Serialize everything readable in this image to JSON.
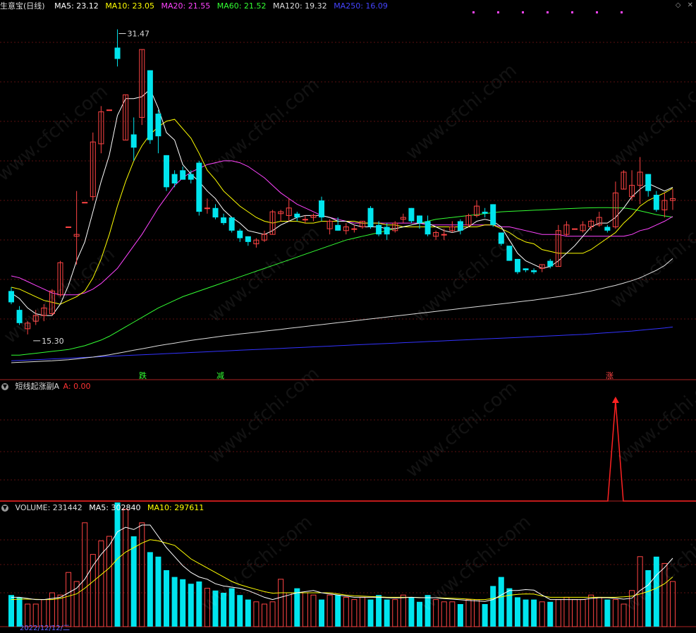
{
  "header": {
    "title": "生意宝(日线)",
    "ma": [
      {
        "label": "MA5: 23.12",
        "color": "#ffffff"
      },
      {
        "label": "MA10: 23.05",
        "color": "#ffff00"
      },
      {
        "label": "MA20: 21.55",
        "color": "#ff44ff"
      },
      {
        "label": "MA60: 21.52",
        "color": "#33ff33"
      },
      {
        "label": "MA120: 19.32",
        "color": "#dddddd"
      },
      {
        "label": "MA250: 16.09",
        "color": "#3333ff"
      }
    ]
  },
  "indicator": {
    "title": "短线起涨副A",
    "value_label": "A: 0.00",
    "value_color": "#ff3333"
  },
  "volume_header": {
    "vol_label": "VOLUME: 231442",
    "ma5_label": "MA5: 302840",
    "ma10_label": "MA10: 297611"
  },
  "annotations": {
    "high": "31.47",
    "low": "15.30"
  },
  "signals": [
    {
      "text": "跌",
      "color": "#33ff33"
    },
    {
      "text": "减",
      "color": "#33ff33"
    },
    {
      "text": "涨",
      "color": "#ff4444"
    }
  ],
  "date_label": "2022/12/12/二",
  "watermark": "www.cfchi.com",
  "colors": {
    "up": "#ff4444",
    "down": "#00e5ee",
    "ma5": "#ffffff",
    "ma10": "#ffff00",
    "ma20": "#ff44ff",
    "ma60": "#33ff33",
    "ma120": "#dddddd",
    "ma250": "#3333ff"
  },
  "chart_data": {
    "type": "candlestick",
    "ylim": [
      13.5,
      32.5
    ],
    "candles": [
      [
        17.6,
        17.8,
        16.9,
        17.0
      ],
      [
        16.6,
        16.8,
        15.8,
        15.9
      ],
      [
        15.6,
        16.0,
        15.3,
        15.9
      ],
      [
        16.0,
        16.6,
        15.8,
        16.3
      ],
      [
        16.3,
        16.9,
        16.0,
        16.7
      ],
      [
        16.4,
        17.7,
        16.3,
        17.6
      ],
      [
        17.4,
        19.2,
        17.3,
        19.1
      ],
      [
        21.0,
        21.0,
        21.0,
        21.0
      ],
      [
        20.5,
        22.9,
        19.0,
        20.6
      ],
      [
        22.3,
        22.3,
        22.3,
        22.3
      ],
      [
        22.6,
        26.0,
        22.4,
        25.5
      ],
      [
        25.4,
        27.4,
        24.9,
        27.1
      ],
      [
        27.2,
        27.2,
        27.2,
        27.2
      ],
      [
        30.5,
        31.47,
        29.5,
        29.9
      ],
      [
        25.6,
        28.0,
        25.6,
        28.0
      ],
      [
        25.9,
        26.8,
        24.5,
        25.2
      ],
      [
        26.8,
        30.4,
        26.4,
        30.4
      ],
      [
        29.3,
        29.3,
        25.4,
        25.6
      ],
      [
        27.0,
        27.2,
        24.9,
        25.8
      ],
      [
        24.8,
        24.8,
        22.9,
        23.1
      ],
      [
        23.8,
        24.0,
        23.1,
        23.3
      ],
      [
        24.0,
        24.2,
        23.5,
        23.5
      ],
      [
        23.8,
        24.0,
        23.3,
        23.5
      ],
      [
        24.4,
        24.5,
        21.6,
        21.8
      ],
      [
        22.0,
        22.5,
        21.7,
        22.0
      ],
      [
        22.0,
        22.2,
        21.4,
        21.5
      ],
      [
        21.5,
        21.7,
        21.1,
        21.2
      ],
      [
        21.5,
        21.5,
        20.7,
        20.8
      ],
      [
        20.8,
        20.9,
        20.2,
        20.4
      ],
      [
        20.5,
        20.5,
        20.0,
        20.2
      ],
      [
        20.1,
        20.4,
        19.9,
        20.3
      ],
      [
        20.3,
        20.8,
        20.2,
        20.6
      ],
      [
        20.6,
        21.9,
        20.6,
        21.8
      ],
      [
        21.7,
        21.9,
        21.3,
        21.8
      ],
      [
        21.6,
        22.5,
        21.3,
        22.0
      ],
      [
        21.7,
        21.8,
        21.3,
        21.5
      ],
      [
        21.4,
        21.6,
        21.2,
        21.4
      ],
      [
        21.5,
        21.7,
        21.3,
        21.6
      ],
      [
        22.4,
        22.6,
        21.3,
        21.5
      ],
      [
        20.9,
        21.4,
        20.6,
        21.3
      ],
      [
        21.1,
        21.5,
        20.8,
        20.8
      ],
      [
        20.8,
        21.2,
        20.6,
        21.0
      ],
      [
        20.9,
        21.1,
        20.7,
        20.9
      ],
      [
        21.0,
        21.3,
        20.9,
        21.3
      ],
      [
        22.0,
        22.1,
        20.9,
        21.0
      ],
      [
        21.1,
        21.3,
        20.5,
        20.6
      ],
      [
        21.0,
        21.2,
        20.3,
        20.6
      ],
      [
        20.8,
        21.3,
        20.7,
        21.2
      ],
      [
        21.4,
        21.7,
        21.2,
        21.5
      ],
      [
        22.0,
        22.0,
        21.2,
        21.3
      ],
      [
        21.6,
        21.6,
        20.9,
        21.2
      ],
      [
        21.3,
        21.6,
        20.5,
        20.6
      ],
      [
        20.5,
        20.8,
        20.3,
        20.7
      ],
      [
        20.6,
        20.9,
        20.3,
        20.6
      ],
      [
        20.8,
        21.3,
        20.7,
        21.0
      ],
      [
        21.3,
        21.4,
        20.6,
        20.8
      ],
      [
        21.1,
        21.7,
        21.0,
        21.6
      ],
      [
        21.6,
        22.4,
        21.5,
        22.1
      ],
      [
        21.8,
        22.0,
        21.5,
        21.7
      ],
      [
        22.2,
        22.2,
        21.0,
        21.1
      ],
      [
        20.7,
        20.7,
        20.0,
        20.1
      ],
      [
        20.0,
        20.0,
        19.2,
        19.2
      ],
      [
        19.3,
        19.3,
        18.5,
        18.6
      ],
      [
        18.8,
        18.8,
        18.6,
        18.7
      ],
      [
        18.7,
        18.8,
        18.5,
        18.6
      ],
      [
        18.8,
        19.0,
        18.6,
        19.0
      ],
      [
        19.2,
        19.3,
        18.8,
        18.9
      ],
      [
        18.9,
        21.1,
        18.9,
        20.8
      ],
      [
        20.6,
        21.3,
        20.5,
        21.1
      ],
      [
        20.9,
        20.9,
        20.9,
        20.9
      ],
      [
        20.8,
        21.3,
        20.7,
        21.1
      ],
      [
        21.0,
        21.4,
        20.8,
        21.3
      ],
      [
        21.1,
        21.8,
        21.0,
        21.5
      ],
      [
        21.0,
        21.1,
        20.7,
        20.8
      ],
      [
        21.0,
        23.4,
        20.9,
        22.8
      ],
      [
        23.0,
        24.0,
        23.0,
        23.9
      ],
      [
        22.6,
        24.0,
        22.4,
        23.2
      ],
      [
        23.2,
        24.7,
        22.2,
        23.9
      ],
      [
        23.8,
        23.8,
        22.6,
        22.9
      ],
      [
        22.7,
        22.9,
        21.8,
        21.9
      ],
      [
        21.9,
        22.8,
        21.5,
        22.4
      ],
      [
        22.4,
        23.0,
        21.9,
        22.5
      ]
    ],
    "ma5": [
      17.5,
      17.2,
      16.7,
      16.4,
      16.3,
      16.3,
      16.9,
      17.9,
      19.2,
      20.2,
      21.8,
      23.4,
      24.8,
      26.9,
      27.8,
      27.8,
      27.9,
      28.3,
      27.3,
      26.0,
      25.6,
      24.3,
      23.8,
      23.4,
      22.9,
      22.5,
      21.9,
      21.5,
      21.2,
      20.8,
      20.7,
      20.6,
      20.8,
      21.1,
      21.3,
      21.5,
      21.6,
      21.6,
      21.6,
      21.5,
      21.3,
      21.3,
      21.1,
      21.0,
      21.0,
      21.0,
      20.9,
      20.9,
      21.0,
      21.1,
      21.2,
      21.2,
      21.0,
      20.8,
      20.7,
      20.8,
      21.0,
      21.3,
      21.4,
      21.3,
      21.0,
      20.3,
      19.6,
      19.2,
      19.0,
      18.8,
      18.9,
      19.2,
      19.6,
      20.0,
      20.5,
      21.0,
      21.2,
      21.2,
      21.5,
      22.0,
      22.6,
      23.0,
      23.3,
      23.1,
      22.9,
      23.1
    ],
    "ma10": [
      17.8,
      17.7,
      17.5,
      17.3,
      17.1,
      17.0,
      16.9,
      17.1,
      17.3,
      17.6,
      18.3,
      19.3,
      20.6,
      22.1,
      23.4,
      24.5,
      25.3,
      25.9,
      26.3,
      26.6,
      26.7,
      26.2,
      25.7,
      24.9,
      24.0,
      23.5,
      22.9,
      22.5,
      22.1,
      21.8,
      21.5,
      21.3,
      21.2,
      21.3,
      21.3,
      21.3,
      21.2,
      21.2,
      21.3,
      21.3,
      21.3,
      21.3,
      21.3,
      21.2,
      21.2,
      21.2,
      21.1,
      21.1,
      21.0,
      21.0,
      21.0,
      21.0,
      21.0,
      21.0,
      21.0,
      21.0,
      21.0,
      21.0,
      21.1,
      21.1,
      20.9,
      20.7,
      20.4,
      20.2,
      20.1,
      19.8,
      19.7,
      19.6,
      19.6,
      19.6,
      19.6,
      19.8,
      20.1,
      20.4,
      20.7,
      21.2,
      21.6,
      22.1,
      22.4,
      22.6,
      22.8,
      23.05
    ],
    "ma20": [
      18.4,
      18.3,
      18.1,
      17.9,
      17.7,
      17.5,
      17.4,
      17.4,
      17.4,
      17.5,
      17.7,
      18.0,
      18.4,
      18.8,
      19.4,
      20.0,
      20.6,
      21.3,
      22.0,
      22.6,
      23.2,
      23.6,
      23.9,
      24.1,
      24.3,
      24.4,
      24.5,
      24.5,
      24.4,
      24.2,
      23.9,
      23.6,
      23.2,
      22.8,
      22.5,
      22.2,
      22.0,
      21.8,
      21.6,
      21.5,
      21.4,
      21.3,
      21.2,
      21.2,
      21.2,
      21.2,
      21.2,
      21.2,
      21.2,
      21.2,
      21.2,
      21.1,
      21.1,
      21.1,
      21.1,
      21.1,
      21.1,
      21.1,
      21.1,
      21.1,
      21.0,
      21.0,
      20.9,
      20.8,
      20.7,
      20.6,
      20.6,
      20.6,
      20.5,
      20.5,
      20.5,
      20.5,
      20.5,
      20.5,
      20.5,
      20.5,
      20.6,
      20.8,
      20.9,
      21.1,
      21.3,
      21.55
    ],
    "ma60": [
      14.2,
      14.2,
      14.25,
      14.3,
      14.35,
      14.4,
      14.45,
      14.5,
      14.6,
      14.7,
      14.85,
      15.0,
      15.2,
      15.45,
      15.7,
      15.95,
      16.2,
      16.45,
      16.7,
      16.9,
      17.1,
      17.3,
      17.45,
      17.6,
      17.75,
      17.9,
      18.05,
      18.2,
      18.35,
      18.5,
      18.65,
      18.8,
      18.95,
      19.1,
      19.25,
      19.4,
      19.55,
      19.7,
      19.85,
      20.0,
      20.15,
      20.3,
      20.4,
      20.5,
      20.6,
      20.7,
      20.8,
      20.9,
      21.0,
      21.1,
      21.2,
      21.3,
      21.4,
      21.45,
      21.5,
      21.55,
      21.6,
      21.65,
      21.7,
      21.75,
      21.8,
      21.82,
      21.84,
      21.86,
      21.88,
      21.9,
      21.92,
      21.94,
      21.96,
      21.98,
      22.0,
      22.01,
      22.02,
      22.02,
      22.01,
      22.0,
      21.95,
      21.85,
      21.75,
      21.65,
      21.58,
      21.52
    ],
    "ma120": [
      13.8,
      13.82,
      13.84,
      13.86,
      13.88,
      13.9,
      13.93,
      13.96,
      14.0,
      14.05,
      14.1,
      14.16,
      14.22,
      14.3,
      14.38,
      14.46,
      14.54,
      14.62,
      14.7,
      14.77,
      14.84,
      14.91,
      14.98,
      15.04,
      15.1,
      15.16,
      15.22,
      15.27,
      15.32,
      15.37,
      15.42,
      15.47,
      15.52,
      15.57,
      15.62,
      15.67,
      15.72,
      15.77,
      15.82,
      15.87,
      15.92,
      15.97,
      16.02,
      16.07,
      16.12,
      16.17,
      16.22,
      16.27,
      16.32,
      16.37,
      16.42,
      16.47,
      16.52,
      16.57,
      16.62,
      16.67,
      16.72,
      16.77,
      16.82,
      16.87,
      16.92,
      16.97,
      17.02,
      17.07,
      17.12,
      17.18,
      17.24,
      17.3,
      17.37,
      17.44,
      17.52,
      17.6,
      17.7,
      17.8,
      17.9,
      18.02,
      18.15,
      18.3,
      18.5,
      18.7,
      18.95,
      19.32
    ],
    "ma250": [
      13.9,
      13.92,
      13.94,
      13.96,
      13.98,
      14.0,
      14.02,
      14.04,
      14.06,
      14.08,
      14.1,
      14.12,
      14.14,
      14.16,
      14.18,
      14.2,
      14.22,
      14.24,
      14.26,
      14.28,
      14.3,
      14.32,
      14.34,
      14.36,
      14.38,
      14.4,
      14.42,
      14.44,
      14.46,
      14.48,
      14.5,
      14.52,
      14.54,
      14.56,
      14.58,
      14.6,
      14.62,
      14.64,
      14.66,
      14.68,
      14.7,
      14.72,
      14.74,
      14.76,
      14.78,
      14.8,
      14.82,
      14.84,
      14.86,
      14.88,
      14.9,
      14.92,
      14.94,
      14.96,
      14.98,
      15.0,
      15.02,
      15.04,
      15.06,
      15.08,
      15.1,
      15.12,
      15.14,
      15.16,
      15.18,
      15.2,
      15.22,
      15.24,
      15.26,
      15.28,
      15.3,
      15.33,
      15.36,
      15.39,
      15.42,
      15.45,
      15.48,
      15.52,
      15.56,
      15.6,
      15.64,
      15.69
    ],
    "volume": [
      14,
      13,
      10,
      10,
      12,
      15,
      14,
      24,
      20,
      46,
      32,
      38,
      40,
      55,
      52,
      40,
      46,
      33,
      31,
      25,
      22,
      21,
      19,
      20,
      17,
      16,
      15,
      17,
      14,
      12,
      11,
      10,
      11,
      21,
      15,
      17,
      15,
      14,
      12,
      14,
      14,
      13,
      12,
      13,
      12,
      14,
      12,
      12,
      14,
      13,
      11,
      14,
      12,
      11,
      11,
      10,
      12,
      12,
      10,
      18,
      22,
      17,
      13,
      12,
      12,
      11,
      11,
      12,
      13,
      12,
      12,
      14,
      13,
      12,
      12,
      10,
      16,
      31,
      25,
      31,
      28,
      20
    ],
    "vol_ma5": [
      13,
      13,
      12.5,
      12,
      12,
      12.5,
      13,
      15,
      17,
      21,
      27,
      32,
      36,
      42,
      44,
      43,
      45,
      45,
      40,
      35,
      31,
      27,
      24,
      22,
      21,
      19,
      18,
      17.5,
      17,
      16,
      14.5,
      13,
      12,
      13,
      14,
      15,
      15.5,
      16,
      15,
      14.5,
      14,
      13.5,
      13,
      13,
      13,
      13,
      12.8,
      12.7,
      12.8,
      13,
      12.8,
      12.8,
      12.8,
      12.4,
      12.2,
      11.9,
      11.6,
      11.4,
      11.2,
      12,
      14,
      16,
      16,
      16.4,
      16.2,
      14,
      12,
      12,
      12,
      12,
      12,
      12.5,
      12.8,
      12.8,
      12.6,
      12.2,
      12.6,
      16,
      18.4,
      22.8,
      26.2,
      30.3
    ],
    "vol_ma10": [
      12,
      12.2,
      12.2,
      12.1,
      12,
      12,
      12.5,
      13.5,
      14.5,
      17,
      20,
      23,
      26,
      30,
      33,
      35,
      37,
      38.5,
      38,
      37,
      36,
      33,
      30,
      28,
      26,
      24,
      22,
      20,
      18.6,
      17.5,
      16.5,
      15.5,
      14.8,
      15,
      15,
      15,
      15,
      15,
      15,
      15,
      14.5,
      14,
      13.7,
      13.5,
      13.3,
      13.2,
      13,
      13,
      13,
      13,
      12.9,
      12.8,
      12.8,
      12.7,
      12.6,
      12.4,
      12.2,
      12,
      12,
      12.5,
      13.2,
      13.9,
      14.3,
      14.5,
      14.4,
      13.6,
      13,
      13,
      13,
      13,
      13,
      13,
      13,
      13,
      13,
      13.2,
      13.5,
      14.5,
      15.6,
      17,
      19,
      22
    ]
  }
}
